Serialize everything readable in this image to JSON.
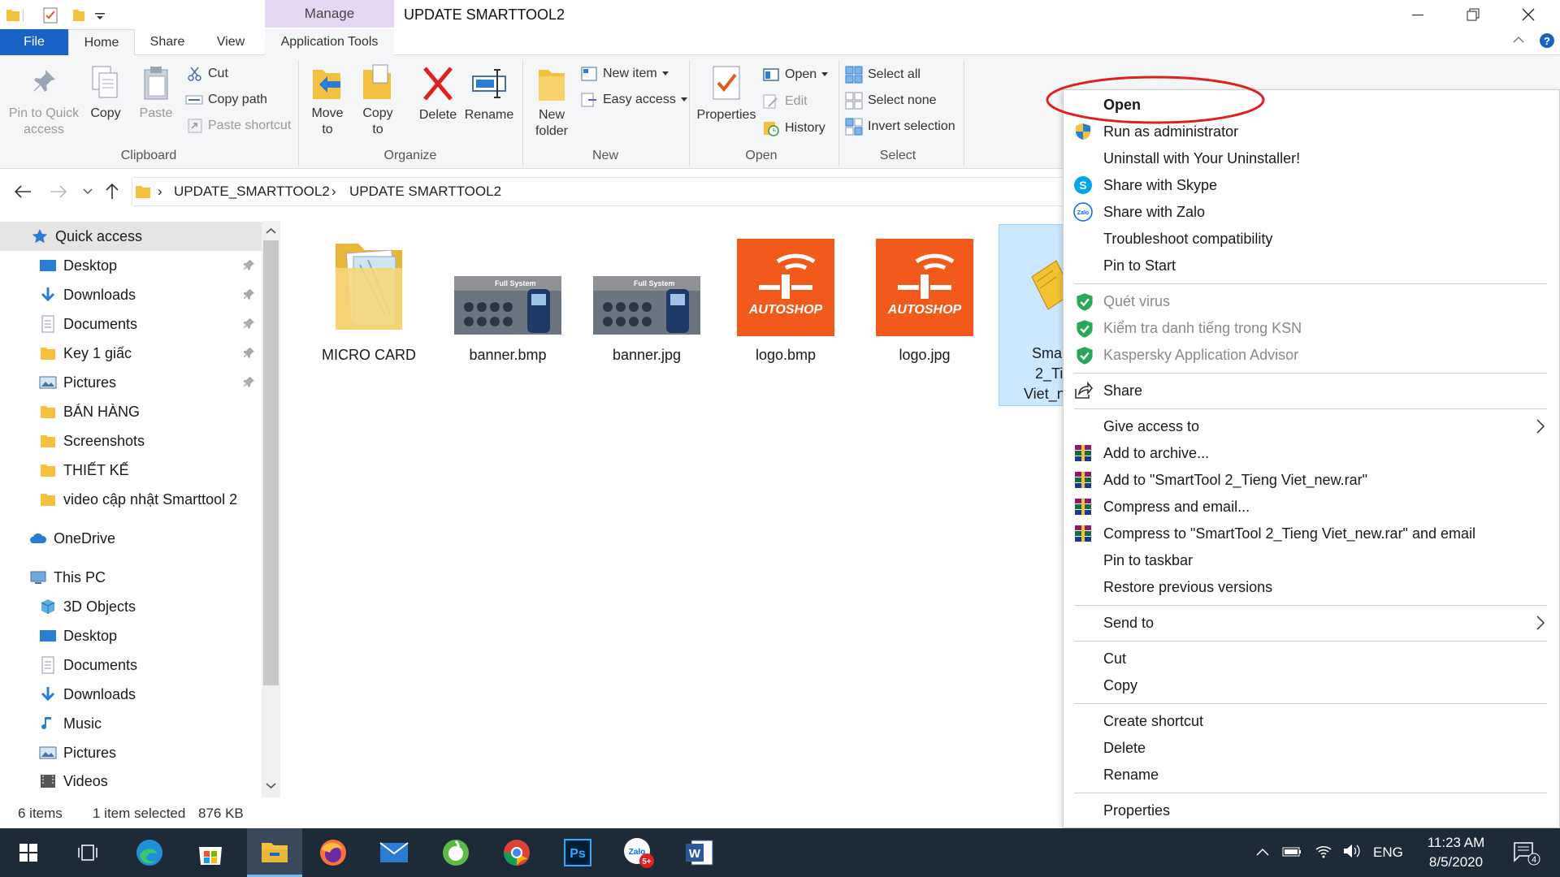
{
  "window": {
    "title": "UPDATE SMARTTOOL2",
    "manage_label": "Manage"
  },
  "tabs": [
    "File",
    "Home",
    "Share",
    "View",
    "Application Tools"
  ],
  "ribbon": {
    "clipboard": {
      "pin_label": "Pin to Quick access",
      "copy_label": "Copy",
      "paste_label": "Paste",
      "cut_label": "Cut",
      "copy_path_label": "Copy path",
      "paste_shortcut_label": "Paste shortcut",
      "group_label": "Clipboard"
    },
    "organize": {
      "move_to_label": "Move to",
      "copy_to_label": "Copy to",
      "delete_label": "Delete",
      "rename_label": "Rename",
      "group_label": "Organize"
    },
    "new": {
      "new_folder_label": "New folder",
      "new_item_label": "New item",
      "easy_access_label": "Easy access",
      "group_label": "New"
    },
    "open": {
      "properties_label": "Properties",
      "open_label": "Open",
      "edit_label": "Edit",
      "history_label": "History",
      "group_label": "Open"
    },
    "select": {
      "select_all_label": "Select all",
      "select_none_label": "Select none",
      "invert_label": "Invert selection",
      "group_label": "Select"
    }
  },
  "address": {
    "crumbs": [
      "UPDATE_SMARTTOOL2",
      "UPDATE SMARTTOOL2"
    ]
  },
  "nav": {
    "quick_access": "Quick access",
    "quick_items": [
      "Desktop",
      "Downloads",
      "Documents",
      "Key 1 giấc",
      "Pictures",
      "BÁN HÀNG",
      "Screenshots",
      "THIẾT KẾ",
      "video cập nhật Smarttool 2"
    ],
    "onedrive": "OneDrive",
    "this_pc": "This PC",
    "pc_items": [
      "3D Objects",
      "Desktop",
      "Documents",
      "Downloads",
      "Music",
      "Pictures",
      "Videos"
    ]
  },
  "files": [
    {
      "name": "MICRO CARD",
      "icon": "folder-icon"
    },
    {
      "name": "banner.bmp",
      "icon": "banner-thumbnail"
    },
    {
      "name": "banner.jpg",
      "icon": "banner-thumbnail"
    },
    {
      "name": "logo.bmp",
      "icon": "autoshop-logo-thumbnail"
    },
    {
      "name": "logo.jpg",
      "icon": "autoshop-logo-thumbnail"
    },
    {
      "name_lines": [
        "Smar",
        "2_Ti",
        "Viet_n"
      ],
      "icon": "winrar-archive-icon"
    }
  ],
  "thumbnails": {
    "banner_caption": "Full System",
    "logo_text": "AUTOSHOP"
  },
  "context_menu": {
    "items": [
      {
        "label": "Open"
      },
      {
        "label": "Run as administrator",
        "icon": "uac-shield-icon"
      },
      {
        "label": "Uninstall with Your Uninstaller!"
      },
      {
        "label": "Share with Skype",
        "icon": "skype-icon"
      },
      {
        "label": "Share with Zalo",
        "icon": "zalo-icon"
      },
      {
        "label": "Troubleshoot compatibility"
      },
      {
        "label": "Pin to Start"
      },
      {
        "label": "Quét virus",
        "icon": "kaspersky-icon",
        "disabled": true
      },
      {
        "label": "Kiểm tra danh tiếng trong KSN",
        "icon": "kaspersky-icon",
        "disabled": true
      },
      {
        "label": "Kaspersky Application Advisor",
        "icon": "kaspersky-icon",
        "disabled": true
      },
      {
        "label": "Share",
        "icon": "share-icon"
      },
      {
        "label": "Give access to",
        "submenu": true
      },
      {
        "label": "Add to archive...",
        "icon": "winrar-icon"
      },
      {
        "label": "Add to \"SmartTool 2_Tieng Viet_new.rar\"",
        "icon": "winrar-icon"
      },
      {
        "label": "Compress and email...",
        "icon": "winrar-icon"
      },
      {
        "label": "Compress to \"SmartTool 2_Tieng Viet_new.rar\" and email",
        "icon": "winrar-icon"
      },
      {
        "label": "Pin to taskbar"
      },
      {
        "label": "Restore previous versions"
      },
      {
        "label": "Send to",
        "submenu": true
      },
      {
        "label": "Cut"
      },
      {
        "label": "Copy"
      },
      {
        "label": "Create shortcut"
      },
      {
        "label": "Delete"
      },
      {
        "label": "Rename"
      },
      {
        "label": "Properties"
      }
    ],
    "highlight_color": "#e0201f"
  },
  "status": {
    "items_count": "6 items",
    "selection": "1 item selected",
    "size": "876 KB"
  },
  "taskbar": {
    "apps": [
      "start-icon",
      "task-view-icon",
      "edge-icon",
      "store-icon",
      "file-explorer-icon",
      "firefox-icon",
      "mail-icon",
      "coccoc-icon",
      "chrome-icon",
      "photoshop-icon",
      "zalo-icon",
      "word-icon"
    ],
    "ps_label": "Ps",
    "zalo_badge": "5+",
    "word_label": "W",
    "language": "ENG",
    "time": "11:23 AM",
    "date": "8/5/2020",
    "notification_count": "4"
  },
  "colors": {
    "accent": "#1a63c6",
    "manage": "#e6d7f3",
    "selection": "#cce8ff",
    "autoshop_orange": "#f25a1c",
    "taskbar": "#1d2a38"
  }
}
